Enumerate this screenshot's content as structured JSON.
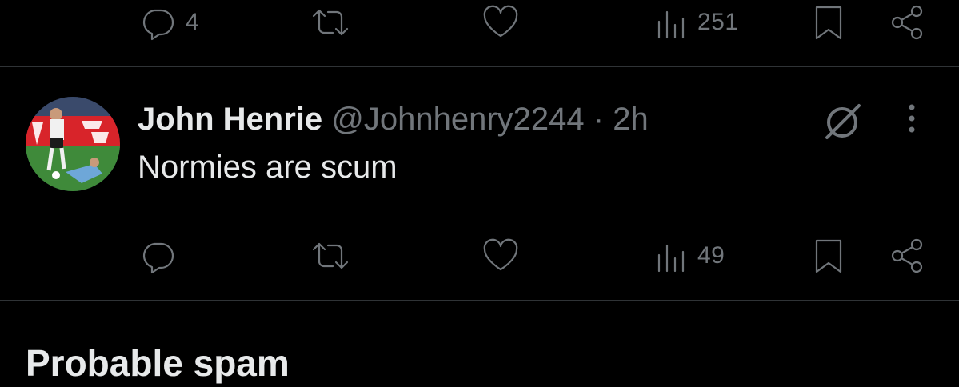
{
  "previous_post": {
    "actions": {
      "reply_count": "4",
      "repost_count": "",
      "like_count": "",
      "view_count": "251"
    }
  },
  "reply": {
    "author_name": "John Henrie",
    "handle": "@Johnhenry2244",
    "separator": "·",
    "time": "2h",
    "text": "Normies are scum",
    "actions": {
      "reply_count": "",
      "repost_count": "",
      "like_count": "",
      "view_count": "49"
    }
  },
  "section": {
    "title": "Probable spam"
  },
  "colors": {
    "background": "#000000",
    "primary_text": "#e7e9ea",
    "secondary_text": "#71767b",
    "divider": "#2f3336"
  },
  "icons": {
    "reply": "reply-bubble-icon",
    "repost": "repost-arrows-icon",
    "like": "heart-icon",
    "views": "views-bar-chart-icon",
    "bookmark": "bookmark-icon",
    "share": "share-icon",
    "grok": "grok-icon",
    "more": "more-vertical-icon"
  }
}
